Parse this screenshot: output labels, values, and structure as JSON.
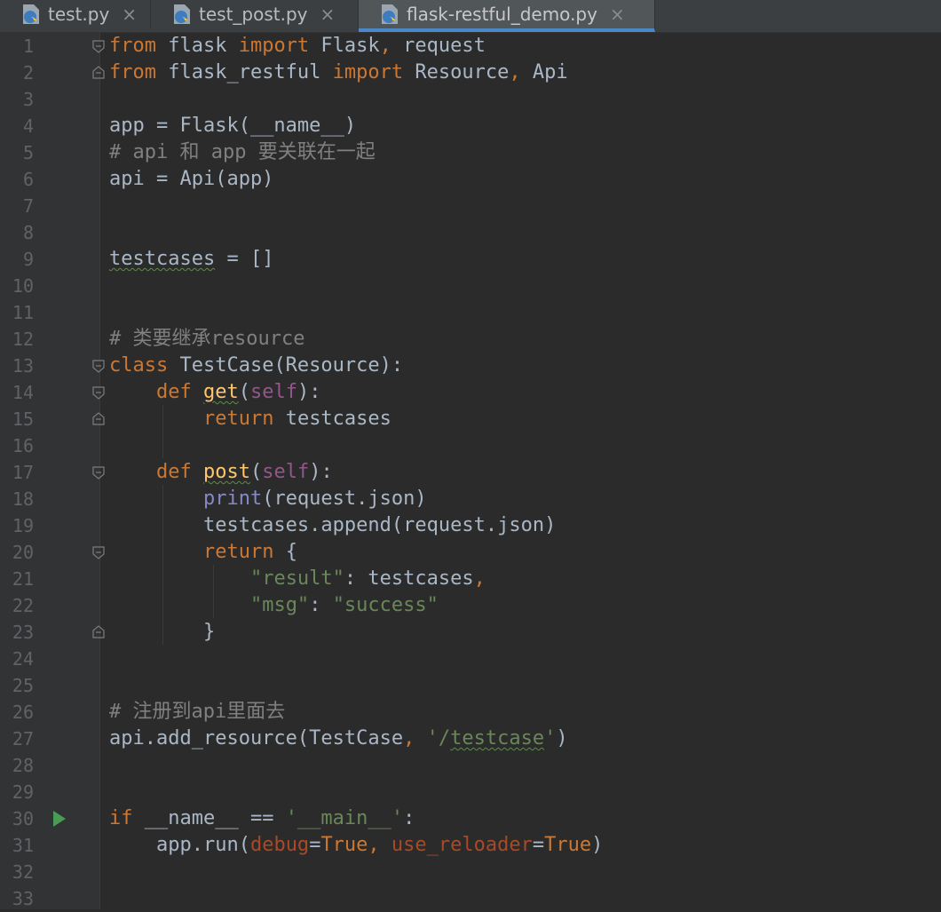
{
  "tabs": [
    {
      "label": "test.py",
      "close": "×",
      "icon": "python-file-icon"
    },
    {
      "label": "test_post.py",
      "close": "×",
      "icon": "python-file-icon"
    },
    {
      "label": "flask-restful_demo.py",
      "close": "×",
      "icon": "python-file-icon",
      "active": true
    }
  ],
  "lines": [
    {
      "n": "1",
      "tokens": [
        {
          "t": "from",
          "c": "kw"
        },
        {
          "t": " flask "
        },
        {
          "t": "import",
          "c": "kw"
        },
        {
          "t": " Flask"
        },
        {
          "t": ",",
          "c": "kw"
        },
        {
          "t": " request"
        }
      ]
    },
    {
      "n": "2",
      "tokens": [
        {
          "t": "from",
          "c": "kw"
        },
        {
          "t": " flask_restful "
        },
        {
          "t": "import",
          "c": "kw"
        },
        {
          "t": " Resource"
        },
        {
          "t": ",",
          "c": "kw"
        },
        {
          "t": " Api"
        }
      ]
    },
    {
      "n": "3",
      "tokens": []
    },
    {
      "n": "4",
      "tokens": [
        {
          "t": "app = Flask(__name__)"
        }
      ]
    },
    {
      "n": "5",
      "tokens": [
        {
          "t": "# api 和 app 要关联在一起",
          "c": "cmt"
        }
      ]
    },
    {
      "n": "6",
      "tokens": [
        {
          "t": "api = Api(app)"
        }
      ]
    },
    {
      "n": "7",
      "tokens": []
    },
    {
      "n": "8",
      "tokens": []
    },
    {
      "n": "9",
      "tokens": [
        {
          "t": "testcases",
          "c": "squig"
        },
        {
          "t": " = []"
        }
      ]
    },
    {
      "n": "10",
      "tokens": []
    },
    {
      "n": "11",
      "tokens": []
    },
    {
      "n": "12",
      "tokens": [
        {
          "t": "# 类要继承resource",
          "c": "cmt"
        }
      ]
    },
    {
      "n": "13",
      "tokens": [
        {
          "t": "class",
          "c": "kw"
        },
        {
          "t": " TestCase(Resource):"
        }
      ]
    },
    {
      "n": "14",
      "tokens": [
        {
          "t": "    "
        },
        {
          "t": "def",
          "c": "kw"
        },
        {
          "t": " "
        },
        {
          "t": "get",
          "c": "fn squig"
        },
        {
          "t": "("
        },
        {
          "t": "self",
          "c": "self"
        },
        {
          "t": "):"
        }
      ]
    },
    {
      "n": "15",
      "tokens": [
        {
          "t": "        "
        },
        {
          "t": "return",
          "c": "kw"
        },
        {
          "t": " testcases"
        }
      ]
    },
    {
      "n": "16",
      "tokens": []
    },
    {
      "n": "17",
      "tokens": [
        {
          "t": "    "
        },
        {
          "t": "def",
          "c": "kw"
        },
        {
          "t": " "
        },
        {
          "t": "post",
          "c": "fn squig"
        },
        {
          "t": "("
        },
        {
          "t": "self",
          "c": "self"
        },
        {
          "t": "):"
        }
      ]
    },
    {
      "n": "18",
      "tokens": [
        {
          "t": "        "
        },
        {
          "t": "print",
          "c": "bi"
        },
        {
          "t": "(request.json)"
        }
      ]
    },
    {
      "n": "19",
      "tokens": [
        {
          "t": "        testcases.append(request.json)"
        }
      ]
    },
    {
      "n": "20",
      "tokens": [
        {
          "t": "        "
        },
        {
          "t": "return",
          "c": "kw"
        },
        {
          "t": " {"
        }
      ]
    },
    {
      "n": "21",
      "tokens": [
        {
          "t": "            "
        },
        {
          "t": "\"result\"",
          "c": "str"
        },
        {
          "t": ": testcases"
        },
        {
          "t": ",",
          "c": "kw"
        }
      ]
    },
    {
      "n": "22",
      "tokens": [
        {
          "t": "            "
        },
        {
          "t": "\"msg\"",
          "c": "str"
        },
        {
          "t": ": "
        },
        {
          "t": "\"success\"",
          "c": "str"
        }
      ]
    },
    {
      "n": "23",
      "tokens": [
        {
          "t": "        }"
        }
      ]
    },
    {
      "n": "24",
      "tokens": []
    },
    {
      "n": "25",
      "tokens": []
    },
    {
      "n": "26",
      "tokens": [
        {
          "t": "# 注册到api里面去",
          "c": "cmt"
        }
      ]
    },
    {
      "n": "27",
      "tokens": [
        {
          "t": "api.add_resource(TestCase"
        },
        {
          "t": ",",
          "c": "kw"
        },
        {
          "t": " "
        },
        {
          "t": "'/",
          "c": "str"
        },
        {
          "t": "testcase",
          "c": "str squig"
        },
        {
          "t": "'",
          "c": "str"
        },
        {
          "t": ")"
        }
      ]
    },
    {
      "n": "28",
      "tokens": []
    },
    {
      "n": "29",
      "tokens": []
    },
    {
      "n": "30",
      "tokens": [
        {
          "t": "if",
          "c": "kw"
        },
        {
          "t": " __name__ == "
        },
        {
          "t": "'__main__'",
          "c": "str"
        },
        {
          "t": ":"
        }
      ],
      "run": true
    },
    {
      "n": "31",
      "tokens": [
        {
          "t": "    app.run("
        },
        {
          "t": "debug",
          "c": "param"
        },
        {
          "t": "="
        },
        {
          "t": "True",
          "c": "kw"
        },
        {
          "t": ", ",
          "c": "kw"
        },
        {
          "t": "use_reloader",
          "c": "param"
        },
        {
          "t": "="
        },
        {
          "t": "True",
          "c": "kw"
        },
        {
          "t": ")"
        }
      ]
    },
    {
      "n": "32",
      "tokens": []
    },
    {
      "n": "33",
      "tokens": []
    }
  ],
  "fold_markers": {
    "1": "open",
    "2": "close",
    "13": "open",
    "14": "open",
    "15": "close",
    "17": "open",
    "20": "open",
    "23": "close"
  },
  "icons": {
    "run": "run-arrow-icon",
    "fold": "fold-marker-icon"
  },
  "colors": {
    "keyword": "#cc7832",
    "comment": "#808080",
    "string": "#6a8759",
    "run": "#499c54"
  }
}
